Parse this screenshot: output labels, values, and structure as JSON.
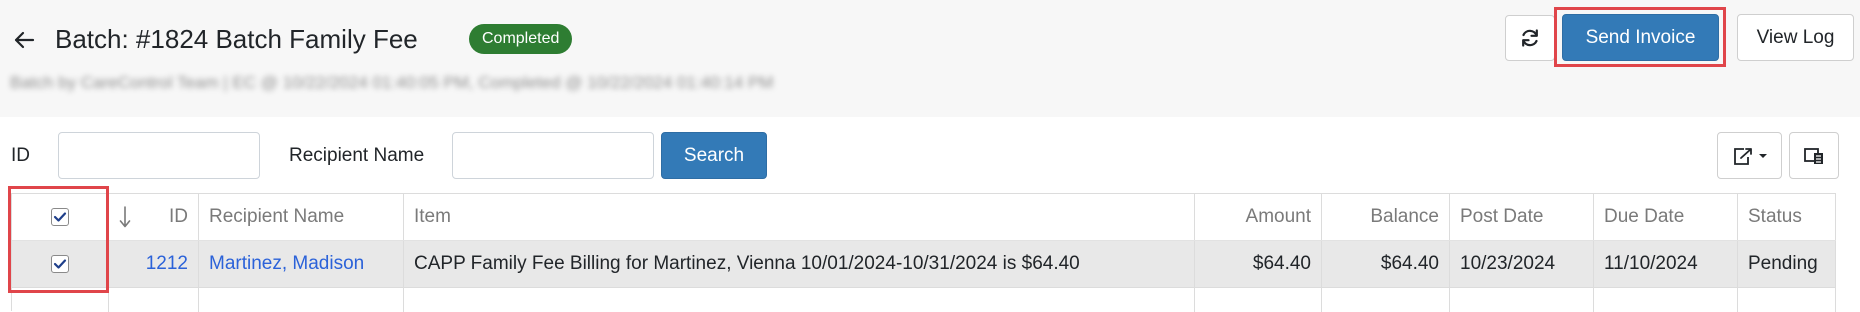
{
  "header": {
    "title": "Batch: #1824 Batch Family Fee",
    "status": "Completed",
    "subtitle": "Batch by CareControl Team | EC @ 10/22/2024 01:40:05 PM, Completed @ 10/22/2024 01:40:14 PM",
    "send_invoice_label": "Send Invoice",
    "view_log_label": "View Log"
  },
  "filters": {
    "id_label": "ID",
    "id_value": "",
    "recipient_label": "Recipient Name",
    "recipient_value": "",
    "search_label": "Search"
  },
  "table": {
    "columns": [
      "ID",
      "Recipient Name",
      "Item",
      "Amount",
      "Balance",
      "Post Date",
      "Due Date",
      "Status"
    ],
    "rows": [
      {
        "id": "1212",
        "recipient": "Martinez, Madison",
        "item": "CAPP Family Fee Billing for Martinez, Vienna 10/01/2024-10/31/2024 is $64.40",
        "amount": "$64.40",
        "balance": "$64.40",
        "post_date": "10/23/2024",
        "due_date": "11/10/2024",
        "status": "Pending",
        "checked": true
      }
    ],
    "select_all_checked": true
  },
  "icons": {
    "back": "arrow-left-icon",
    "refresh": "refresh-icon",
    "export": "export-icon",
    "columns": "columns-icon",
    "sort": "sort-down-icon",
    "check": "checkmark-icon"
  },
  "colors": {
    "primary": "#337ab7",
    "success": "#2e7d32",
    "link": "#2b62d9",
    "highlight": "#e0454a"
  }
}
